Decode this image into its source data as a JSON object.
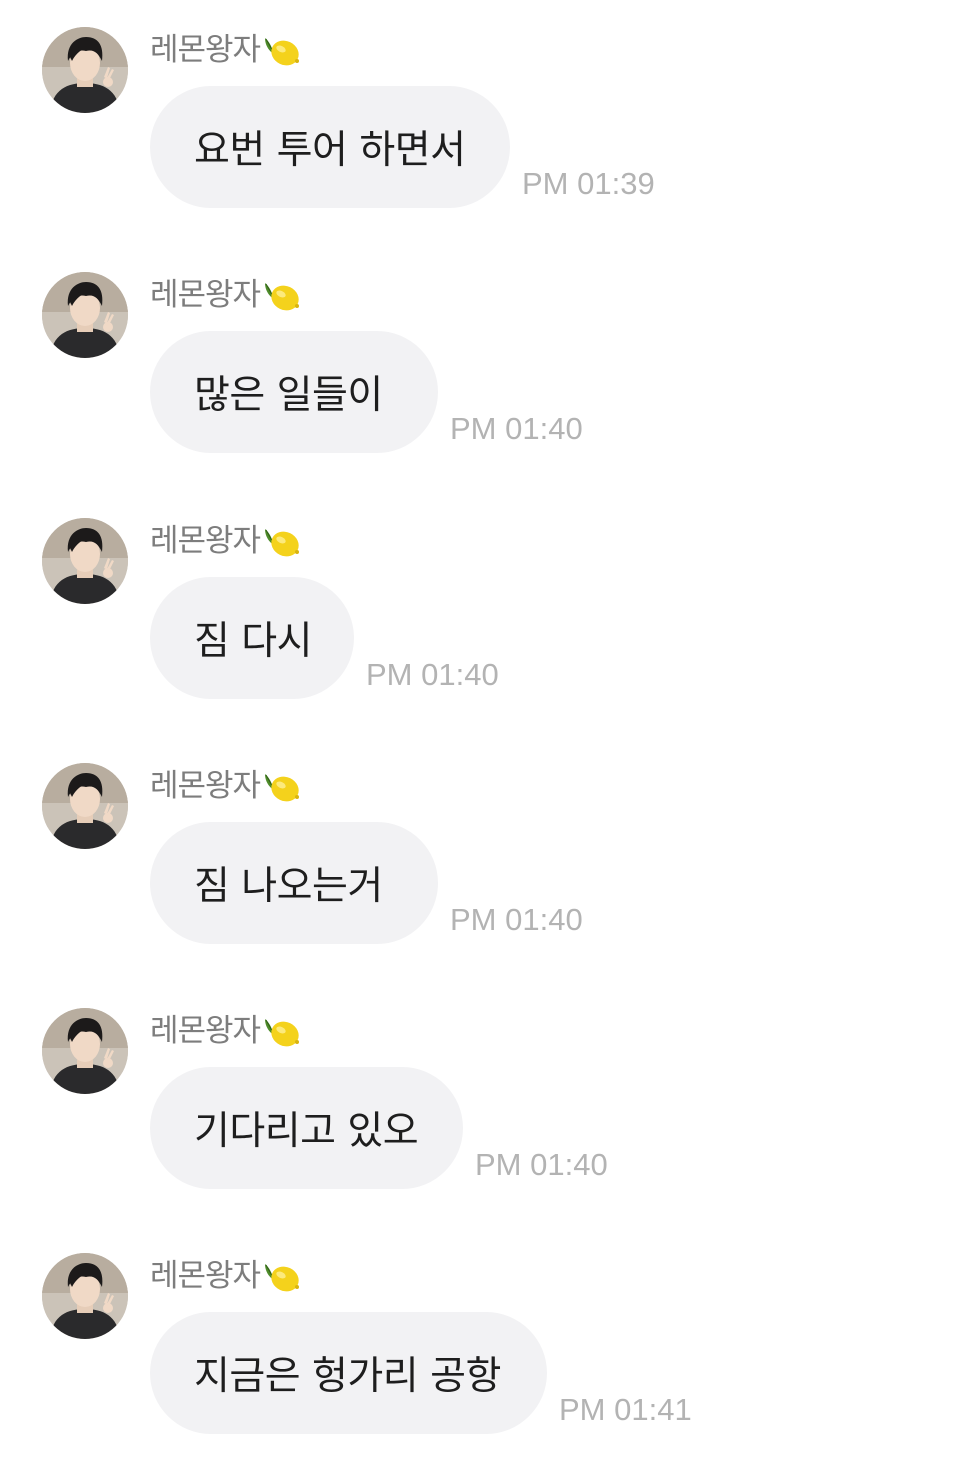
{
  "chat": {
    "sender_name": "레몬왕자",
    "sender_badge_icon": "lemon-icon",
    "avatar_icon": "profile-photo",
    "colors": {
      "bubble": "#f2f2f4",
      "name_text": "#7d7d7d",
      "time_text": "#b3b3b3",
      "lemon": "#f4d21c"
    },
    "messages": [
      {
        "text": "요번 투어 하면서",
        "time": "PM 01:39"
      },
      {
        "text": "많은 일들이",
        "time": "PM 01:40"
      },
      {
        "text": "짐 다시",
        "time": "PM 01:40"
      },
      {
        "text": "짐 나오는거",
        "time": "PM 01:40"
      },
      {
        "text": "기다리고 있오",
        "time": "PM 01:40"
      },
      {
        "text": "지금은 헝가리 공항",
        "time": "PM 01:41"
      }
    ]
  }
}
